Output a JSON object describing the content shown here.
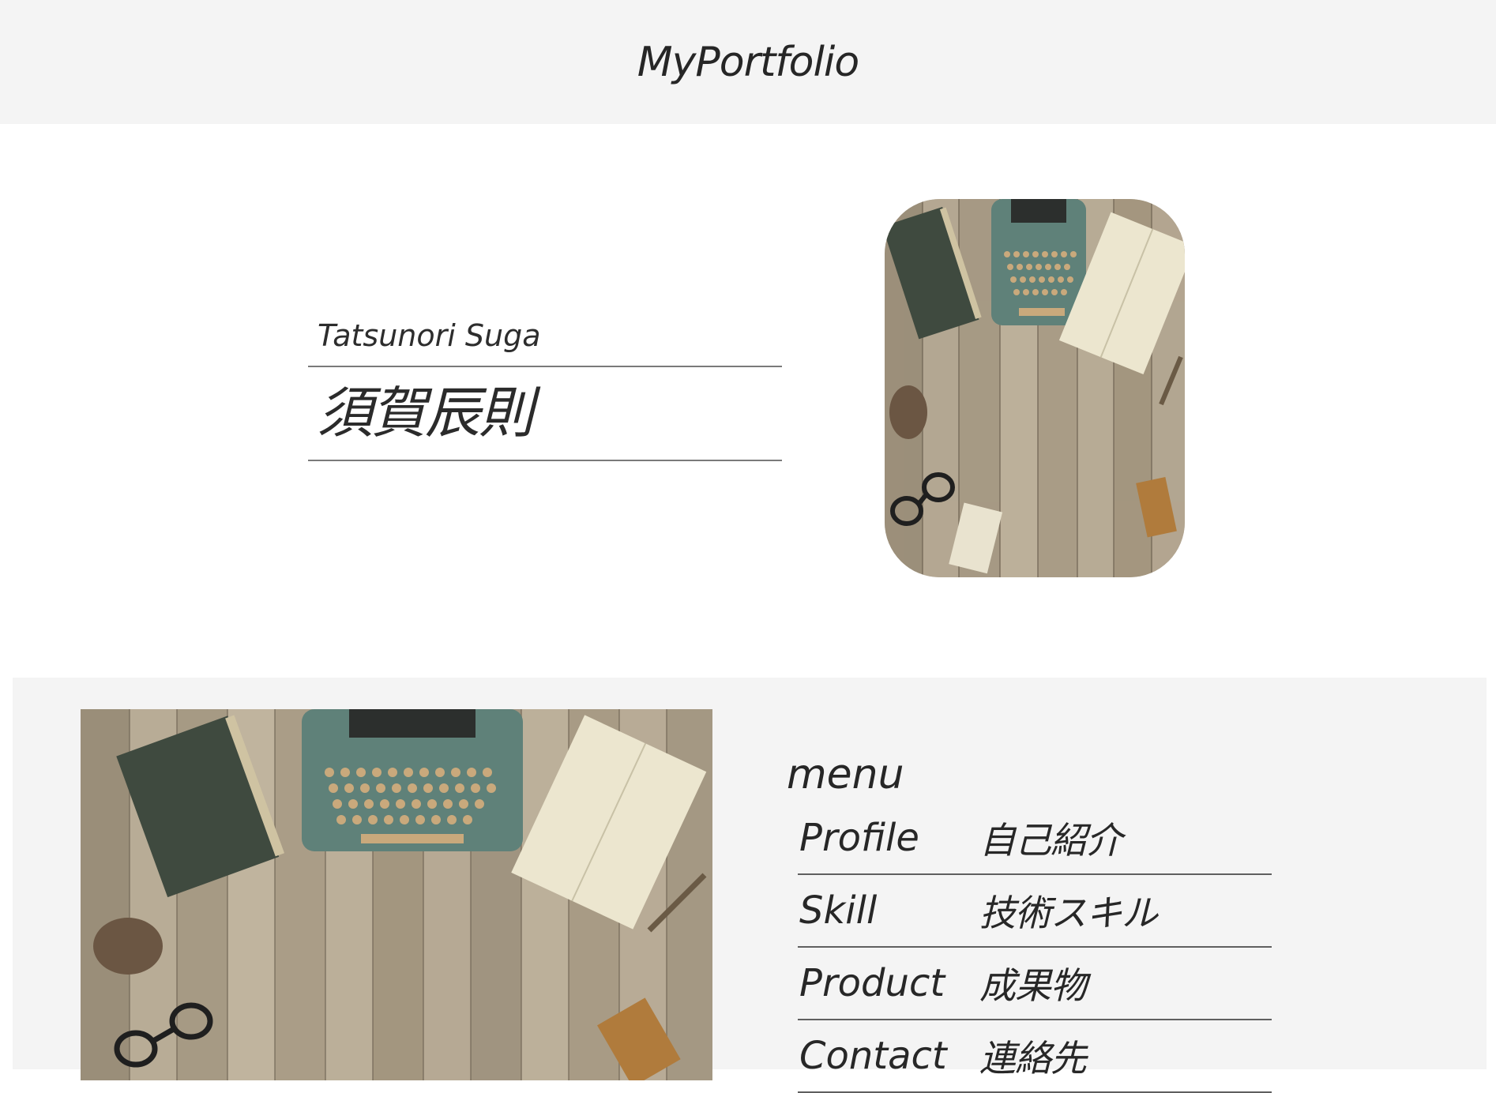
{
  "header": {
    "title": "MyPortfolio"
  },
  "hero": {
    "name_roman": "Tatsunori Suga",
    "name_kanji": "須賀辰則",
    "photo_icon": "typewriter-desk-photo"
  },
  "menu": {
    "heading": "menu",
    "photo_icon": "typewriter-desk-photo",
    "items": [
      {
        "en": "Profile",
        "ja": "自己紹介"
      },
      {
        "en": "Skill",
        "ja": "技術スキル"
      },
      {
        "en": "Product",
        "ja": "成果物"
      },
      {
        "en": "Contact",
        "ja": "連絡先"
      }
    ]
  },
  "colors": {
    "header_bg": "#f4f4f4",
    "section_bg": "#f4f4f4",
    "text": "#2a2a2a",
    "divider": "#7a7a7a"
  }
}
